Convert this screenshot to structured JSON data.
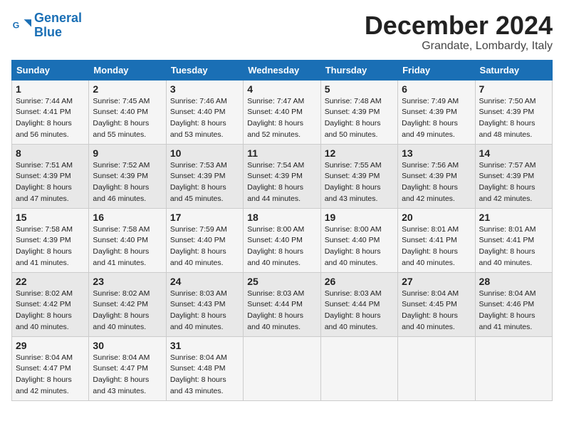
{
  "header": {
    "logo_line1": "General",
    "logo_line2": "Blue",
    "month_title": "December 2024",
    "location": "Grandate, Lombardy, Italy"
  },
  "weekdays": [
    "Sunday",
    "Monday",
    "Tuesday",
    "Wednesday",
    "Thursday",
    "Friday",
    "Saturday"
  ],
  "weeks": [
    [
      {
        "day": "1",
        "sunrise": "7:44 AM",
        "sunset": "4:41 PM",
        "daylight": "8 hours and 56 minutes."
      },
      {
        "day": "2",
        "sunrise": "7:45 AM",
        "sunset": "4:40 PM",
        "daylight": "8 hours and 55 minutes."
      },
      {
        "day": "3",
        "sunrise": "7:46 AM",
        "sunset": "4:40 PM",
        "daylight": "8 hours and 53 minutes."
      },
      {
        "day": "4",
        "sunrise": "7:47 AM",
        "sunset": "4:40 PM",
        "daylight": "8 hours and 52 minutes."
      },
      {
        "day": "5",
        "sunrise": "7:48 AM",
        "sunset": "4:39 PM",
        "daylight": "8 hours and 50 minutes."
      },
      {
        "day": "6",
        "sunrise": "7:49 AM",
        "sunset": "4:39 PM",
        "daylight": "8 hours and 49 minutes."
      },
      {
        "day": "7",
        "sunrise": "7:50 AM",
        "sunset": "4:39 PM",
        "daylight": "8 hours and 48 minutes."
      }
    ],
    [
      {
        "day": "8",
        "sunrise": "7:51 AM",
        "sunset": "4:39 PM",
        "daylight": "8 hours and 47 minutes."
      },
      {
        "day": "9",
        "sunrise": "7:52 AM",
        "sunset": "4:39 PM",
        "daylight": "8 hours and 46 minutes."
      },
      {
        "day": "10",
        "sunrise": "7:53 AM",
        "sunset": "4:39 PM",
        "daylight": "8 hours and 45 minutes."
      },
      {
        "day": "11",
        "sunrise": "7:54 AM",
        "sunset": "4:39 PM",
        "daylight": "8 hours and 44 minutes."
      },
      {
        "day": "12",
        "sunrise": "7:55 AM",
        "sunset": "4:39 PM",
        "daylight": "8 hours and 43 minutes."
      },
      {
        "day": "13",
        "sunrise": "7:56 AM",
        "sunset": "4:39 PM",
        "daylight": "8 hours and 42 minutes."
      },
      {
        "day": "14",
        "sunrise": "7:57 AM",
        "sunset": "4:39 PM",
        "daylight": "8 hours and 42 minutes."
      }
    ],
    [
      {
        "day": "15",
        "sunrise": "7:58 AM",
        "sunset": "4:39 PM",
        "daylight": "8 hours and 41 minutes."
      },
      {
        "day": "16",
        "sunrise": "7:58 AM",
        "sunset": "4:40 PM",
        "daylight": "8 hours and 41 minutes."
      },
      {
        "day": "17",
        "sunrise": "7:59 AM",
        "sunset": "4:40 PM",
        "daylight": "8 hours and 40 minutes."
      },
      {
        "day": "18",
        "sunrise": "8:00 AM",
        "sunset": "4:40 PM",
        "daylight": "8 hours and 40 minutes."
      },
      {
        "day": "19",
        "sunrise": "8:00 AM",
        "sunset": "4:40 PM",
        "daylight": "8 hours and 40 minutes."
      },
      {
        "day": "20",
        "sunrise": "8:01 AM",
        "sunset": "4:41 PM",
        "daylight": "8 hours and 40 minutes."
      },
      {
        "day": "21",
        "sunrise": "8:01 AM",
        "sunset": "4:41 PM",
        "daylight": "8 hours and 40 minutes."
      }
    ],
    [
      {
        "day": "22",
        "sunrise": "8:02 AM",
        "sunset": "4:42 PM",
        "daylight": "8 hours and 40 minutes."
      },
      {
        "day": "23",
        "sunrise": "8:02 AM",
        "sunset": "4:42 PM",
        "daylight": "8 hours and 40 minutes."
      },
      {
        "day": "24",
        "sunrise": "8:03 AM",
        "sunset": "4:43 PM",
        "daylight": "8 hours and 40 minutes."
      },
      {
        "day": "25",
        "sunrise": "8:03 AM",
        "sunset": "4:44 PM",
        "daylight": "8 hours and 40 minutes."
      },
      {
        "day": "26",
        "sunrise": "8:03 AM",
        "sunset": "4:44 PM",
        "daylight": "8 hours and 40 minutes."
      },
      {
        "day": "27",
        "sunrise": "8:04 AM",
        "sunset": "4:45 PM",
        "daylight": "8 hours and 40 minutes."
      },
      {
        "day": "28",
        "sunrise": "8:04 AM",
        "sunset": "4:46 PM",
        "daylight": "8 hours and 41 minutes."
      }
    ],
    [
      {
        "day": "29",
        "sunrise": "8:04 AM",
        "sunset": "4:47 PM",
        "daylight": "8 hours and 42 minutes."
      },
      {
        "day": "30",
        "sunrise": "8:04 AM",
        "sunset": "4:47 PM",
        "daylight": "8 hours and 43 minutes."
      },
      {
        "day": "31",
        "sunrise": "8:04 AM",
        "sunset": "4:48 PM",
        "daylight": "8 hours and 43 minutes."
      },
      null,
      null,
      null,
      null
    ]
  ]
}
